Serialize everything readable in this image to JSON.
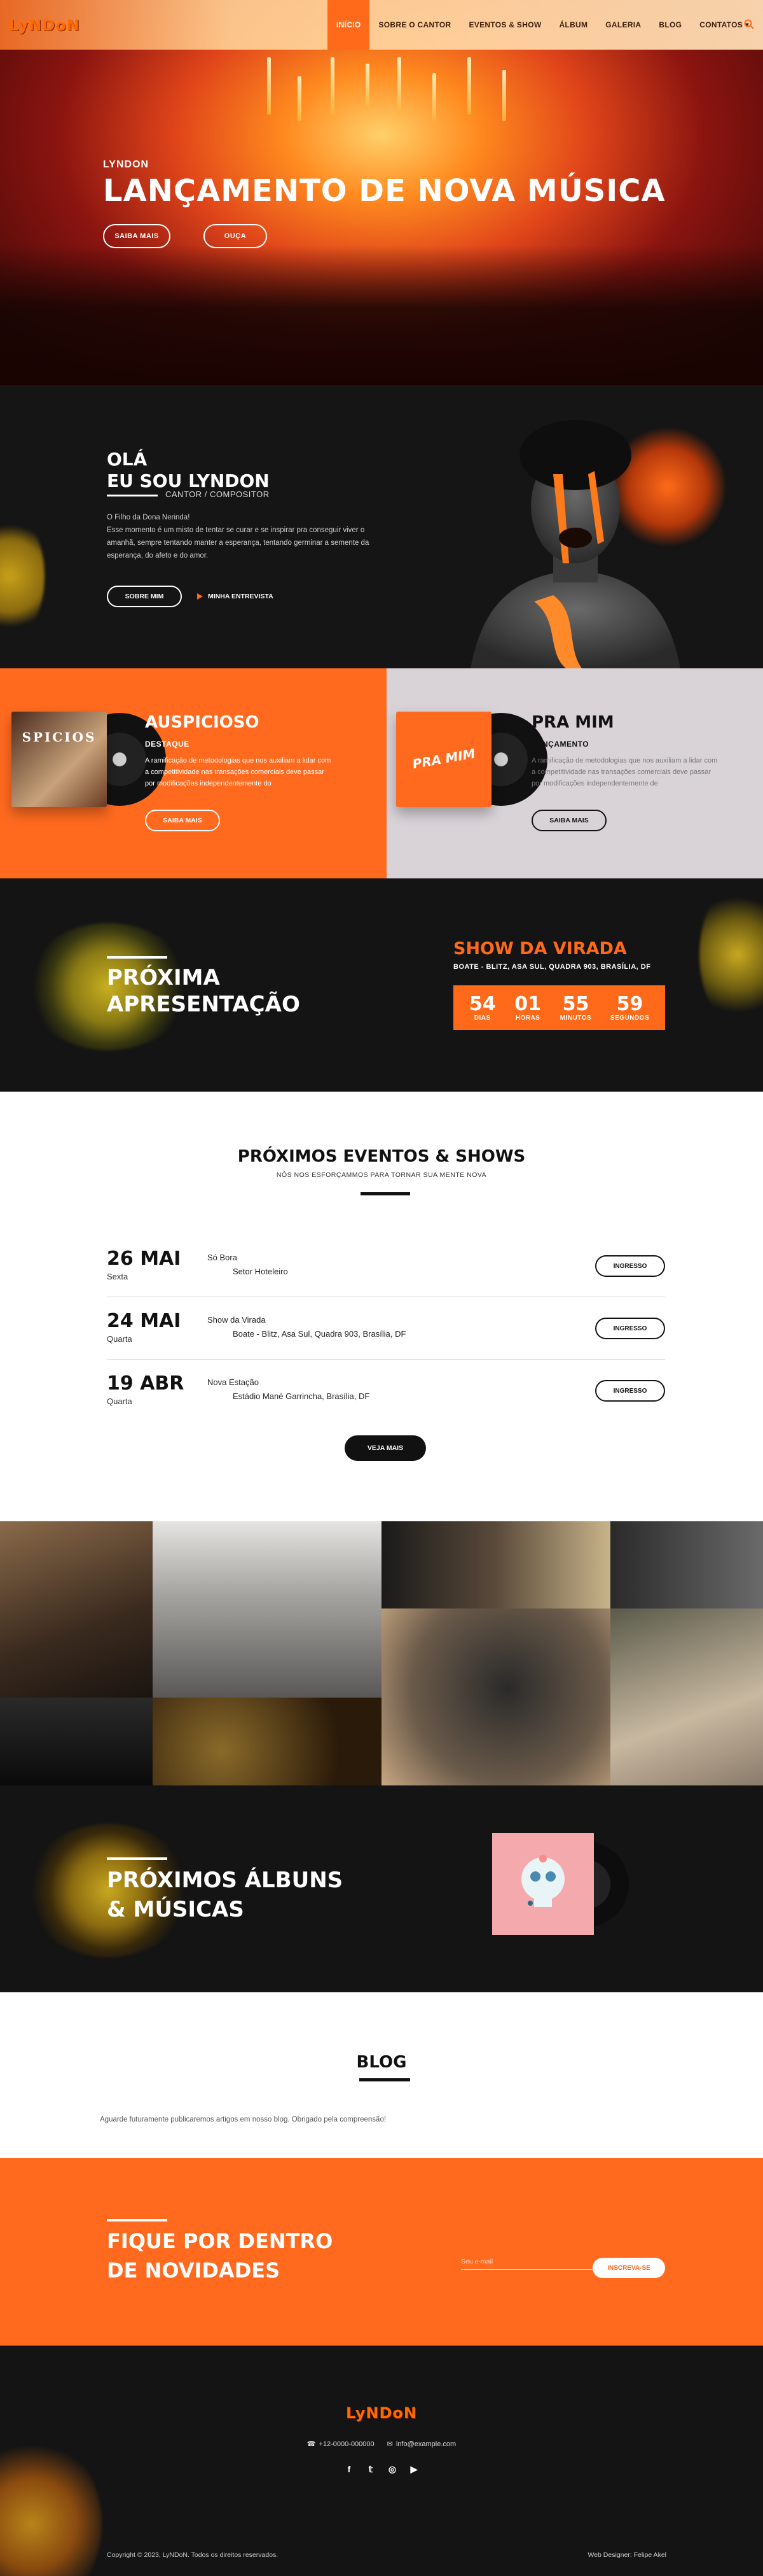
{
  "brand": {
    "logo": "LyNDoN",
    "accent": "#ff6a1a",
    "dark": "#141414"
  },
  "nav": {
    "items": [
      "INÍCIO",
      "SOBRE O CANTOR",
      "EVENTOS & SHOW",
      "ÁLBUM",
      "GALERIA",
      "BLOG",
      "CONTATOS ▾"
    ],
    "active": "INÍCIO"
  },
  "hero": {
    "subtitle": "LYNDON",
    "title": "LANÇAMENTO DE NOVA MÚSICA",
    "btn_more": "SAIBA MAIS",
    "btn_listen": "OUÇA"
  },
  "about": {
    "greeting": "OLÁ",
    "heading": "EU SOU LYNDON",
    "role": "CANTOR / COMPOSITOR",
    "bio": [
      "O Filho da Dona Nerinda!",
      "Esse momento é um misto de tentar se curar e se inspirar pra conseguir viver o amanhã, sempre tentando manter a esperança, tentando germinar a semente da esperança, do afeto e do amor."
    ],
    "btn_about": "SOBRE MIM",
    "interview_link": "MINHA ENTREVISTA"
  },
  "releases": [
    {
      "title": "AUSPICIOSO",
      "tag": "DESTAQUE",
      "cover_text": "SPICIOS",
      "text": "A ramificação de metodologias que nos auxiliam a lidar com a competitividade nas transações comerciais deve passar por modificações independentemente do",
      "btn": "SAIBA MAIS"
    },
    {
      "title": "PRA MIM",
      "tag": "LANÇAMENTO",
      "cover_text": "PRA MIM",
      "text": "A ramificação de metodologias que nos auxiliam a lidar com a competitividade nas transações comerciais deve passar por modificações independentemente de",
      "btn": "SAIBA MAIS"
    }
  ],
  "next_show": {
    "title_line1": "PRÓXIMA",
    "title_line2": "APRESENTAÇÃO",
    "show": "SHOW DA VIRADA",
    "venue": "BOATE - BLITZ, ASA SUL, QUADRA 903, BRASÍLIA, DF",
    "countdown": [
      {
        "value": "54",
        "label": "DIAS"
      },
      {
        "value": "01",
        "label": "HORAS"
      },
      {
        "value": "55",
        "label": "MINUTOS"
      },
      {
        "value": "59",
        "label": "SEGUNDOS"
      }
    ]
  },
  "events": {
    "heading": "PRÓXIMOS EVENTOS & SHOWS",
    "subheading": "NÓS NOS ESFORÇAMMOS PARA TORNAR SUA MENTE NOVA",
    "rows": [
      {
        "date": "26 MAI",
        "weekday": "Sexta",
        "name": "Só Bora",
        "place": "Setor Hoteleiro",
        "btn": "INGRESSO"
      },
      {
        "date": "24 MAI",
        "weekday": "Quarta",
        "name": "Show da Virada",
        "place": "Boate - Blitz, Asa Sul, Quadra 903, Brasília, DF",
        "btn": "INGRESSO"
      },
      {
        "date": "19 ABR",
        "weekday": "Quarta",
        "name": "Nova Estação",
        "place": "Estádio Mané Garrincha, Brasília, DF",
        "btn": "INGRESSO"
      }
    ],
    "more": "VEJA MAIS"
  },
  "albums": {
    "line1": "PRÓXIMOS ÁLBUNS",
    "line2": "& MÚSICAS"
  },
  "blog": {
    "heading": "BLOG",
    "text": "Aguarde futuramente publicaremos artigos em nosso blog. Obrigado pela compreensão!"
  },
  "newsletter": {
    "line1": "FIQUE POR DENTRO",
    "line2": "DE NOVIDADES",
    "placeholder": "Seu e-mail",
    "btn": "INSCREVA-SE"
  },
  "footer": {
    "logo": "LyNDoN",
    "phone": "+12-0000-000000",
    "email": "info@example.com",
    "social": [
      "facebook-icon",
      "twitter-icon",
      "instagram-icon",
      "youtube-icon"
    ],
    "copyright": "Copyright © 2023, LyNDoN. Todos os direitos reservados.",
    "credit": "Web Designer: Felipe Akel"
  }
}
